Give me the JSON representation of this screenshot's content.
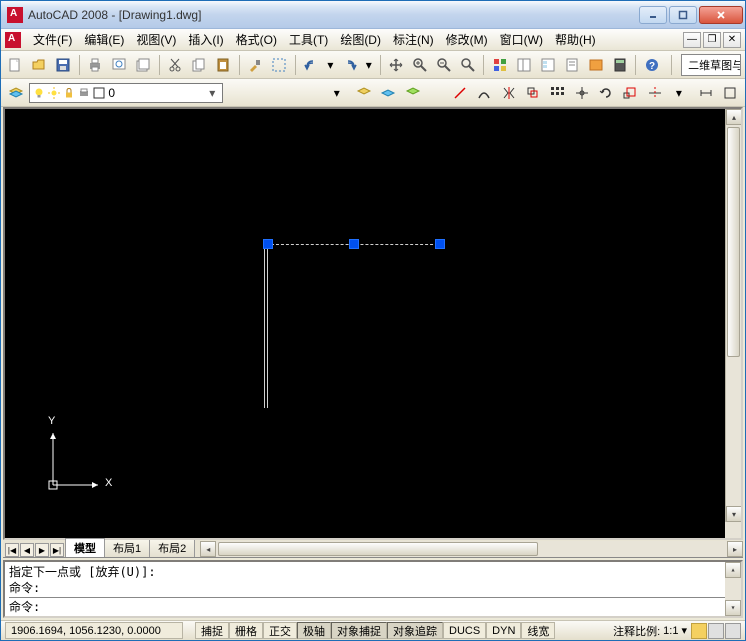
{
  "titlebar": {
    "title": "AutoCAD 2008 - [Drawing1.dwg]"
  },
  "menubar": {
    "items": [
      {
        "label": "文件(F)"
      },
      {
        "label": "编辑(E)"
      },
      {
        "label": "视图(V)"
      },
      {
        "label": "插入(I)"
      },
      {
        "label": "格式(O)"
      },
      {
        "label": "工具(T)"
      },
      {
        "label": "绘图(D)"
      },
      {
        "label": "标注(N)"
      },
      {
        "label": "修改(M)"
      },
      {
        "label": "窗口(W)"
      },
      {
        "label": "帮助(H)"
      }
    ]
  },
  "toolbar1": {
    "workspace_label": "二维草图与"
  },
  "layer_toolbar": {
    "current_layer": "0"
  },
  "tabs": {
    "nav": [
      "|◀",
      "◀",
      "▶",
      "▶|"
    ],
    "items": [
      {
        "label": "模型",
        "active": true
      },
      {
        "label": "布局1",
        "active": false
      },
      {
        "label": "布局2",
        "active": false
      }
    ]
  },
  "command": {
    "line1": "指定下一点或 [放弃(U)]:",
    "line2": "命令:",
    "line3": "命令:"
  },
  "statusbar": {
    "coords": "1906.1694, 1056.1230, 0.0000",
    "toggles": [
      {
        "label": "捕捉",
        "pressed": false
      },
      {
        "label": "栅格",
        "pressed": false
      },
      {
        "label": "正交",
        "pressed": false
      },
      {
        "label": "极轴",
        "pressed": true
      },
      {
        "label": "对象捕捉",
        "pressed": true
      },
      {
        "label": "对象追踪",
        "pressed": true
      },
      {
        "label": "DUCS",
        "pressed": false
      },
      {
        "label": "DYN",
        "pressed": false
      },
      {
        "label": "线宽",
        "pressed": false
      }
    ],
    "scale_label": "注释比例:",
    "scale_value": "1:1"
  },
  "ucs": {
    "x": "X",
    "y": "Y"
  }
}
